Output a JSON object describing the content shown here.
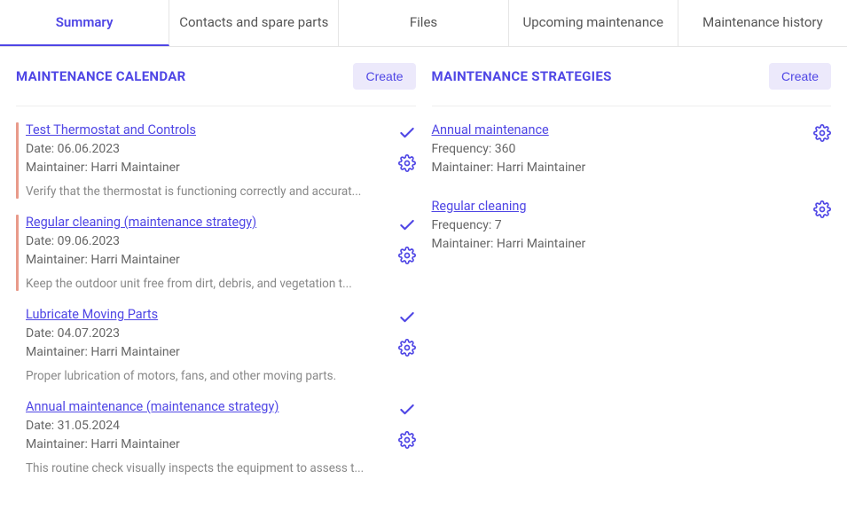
{
  "tabs": [
    {
      "label": "Summary",
      "active": true
    },
    {
      "label": "Contacts and spare parts",
      "active": false
    },
    {
      "label": "Files",
      "active": false
    },
    {
      "label": "Upcoming maintenance",
      "active": false
    },
    {
      "label": "Maintenance history",
      "active": false
    }
  ],
  "calendar": {
    "title": "MAINTENANCE CALENDAR",
    "create_label": "Create",
    "items": [
      {
        "title": "Test Thermostat and Controls",
        "date_label": "Date: 06.06.2023",
        "maintainer_label": "Maintainer: Harri Maintainer",
        "desc": "Verify that the thermostat is functioning correctly and accurat...",
        "accent": true
      },
      {
        "title": "Regular cleaning (maintenance strategy)",
        "date_label": "Date: 09.06.2023",
        "maintainer_label": "Maintainer: Harri Maintainer",
        "desc": "Keep the outdoor unit free from dirt, debris, and vegetation t...",
        "accent": true
      },
      {
        "title": "Lubricate Moving Parts",
        "date_label": "Date: 04.07.2023",
        "maintainer_label": "Maintainer: Harri Maintainer",
        "desc": "Proper lubrication of motors, fans, and other moving parts.",
        "accent": false
      },
      {
        "title": "Annual maintenance (maintenance strategy)",
        "date_label": "Date: 31.05.2024",
        "maintainer_label": "Maintainer: Harri Maintainer",
        "desc": "This routine check visually inspects the equipment to assess t...",
        "accent": false
      }
    ]
  },
  "strategies": {
    "title": "MAINTENANCE STRATEGIES",
    "create_label": "Create",
    "items": [
      {
        "title": "Annual maintenance",
        "freq_label": "Frequency: 360",
        "maintainer_label": "Maintainer: Harri Maintainer"
      },
      {
        "title": "Regular cleaning",
        "freq_label": "Frequency: 7",
        "maintainer_label": "Maintainer: Harri Maintainer"
      }
    ]
  }
}
